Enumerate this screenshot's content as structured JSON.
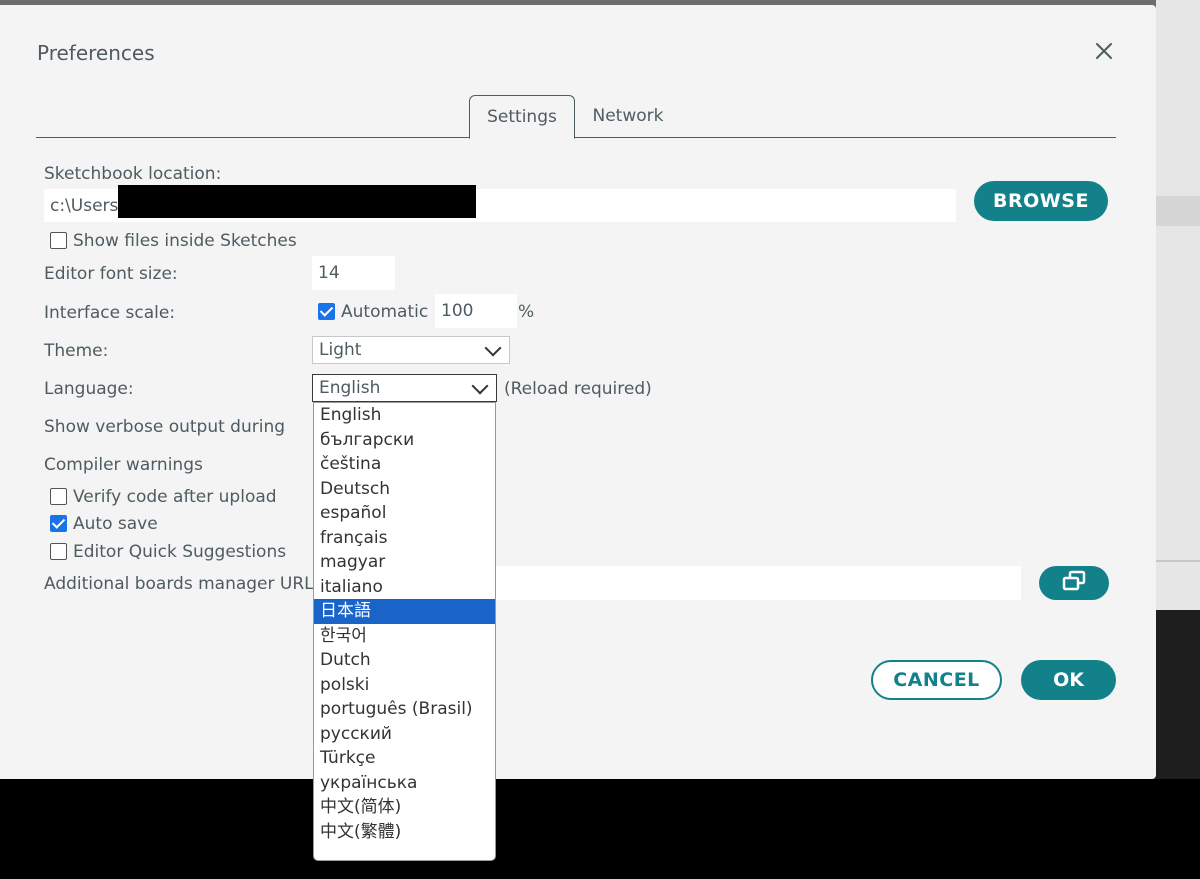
{
  "dialog": {
    "title": "Preferences",
    "close_icon": "close-icon"
  },
  "tabs": [
    {
      "label": "Settings",
      "active": true
    },
    {
      "label": "Network",
      "active": false
    }
  ],
  "settings": {
    "sketchbook_label": "Sketchbook location:",
    "sketchbook_value": "c:\\Users\\",
    "browse_label": "BROWSE",
    "show_files_label": "Show files inside Sketches",
    "show_files_checked": false,
    "font_size_label": "Editor font size:",
    "font_size_value": "14",
    "interface_scale_label": "Interface scale:",
    "automatic_label": "Automatic",
    "automatic_checked": true,
    "scale_value": "100",
    "scale_unit": "%",
    "theme_label": "Theme:",
    "theme_value": "Light",
    "language_label": "Language:",
    "language_value": "English",
    "reload_note": "(Reload required)",
    "verbose_label": "Show verbose output during",
    "compiler_warnings_label": "Compiler warnings",
    "verify_label": "Verify code after upload",
    "verify_checked": false,
    "autosave_label": "Auto save",
    "autosave_checked": true,
    "quick_suggestions_label": "Editor Quick Suggestions",
    "quick_suggestions_checked": false,
    "boards_urls_label": "Additional boards manager URLs",
    "boards_urls_icon": "window-expand-icon"
  },
  "language_options": [
    "English",
    "български",
    "čeština",
    "Deutsch",
    "español",
    "français",
    "magyar",
    "italiano",
    "日本語",
    "한국어",
    "Dutch",
    "polski",
    "português (Brasil)",
    "русский",
    "Türkçe",
    "українська",
    "中文(简体)",
    "中文(繁體)"
  ],
  "language_highlighted_index": 8,
  "footer": {
    "cancel_label": "CANCEL",
    "ok_label": "OK"
  },
  "colors": {
    "accent": "#13818a",
    "checkbox": "#1a73e8",
    "highlight": "#1a63c8"
  }
}
